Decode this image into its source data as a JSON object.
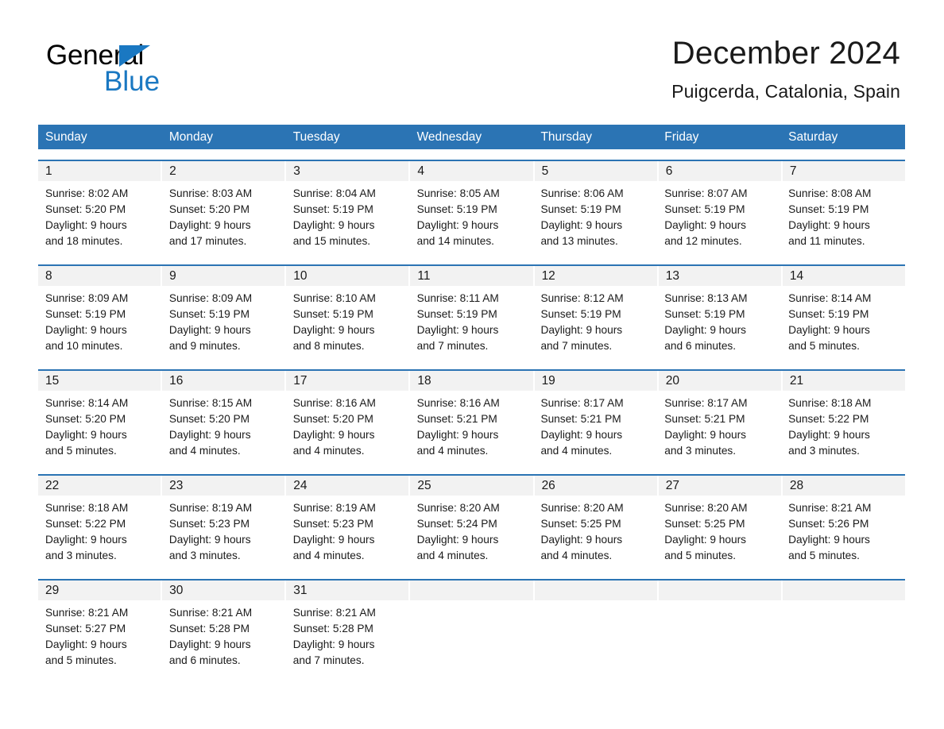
{
  "brand": {
    "name_part1": "General",
    "name_part2": "Blue",
    "triangle_color": "#1a78c2",
    "text_color": "#000000"
  },
  "header": {
    "month_title": "December 2024",
    "location": "Puigcerda, Catalonia, Spain",
    "accent_color": "#2b74b4",
    "band_color": "#f2f2f2"
  },
  "calendar": {
    "weekdays": [
      "Sunday",
      "Monday",
      "Tuesday",
      "Wednesday",
      "Thursday",
      "Friday",
      "Saturday"
    ],
    "weeks": [
      {
        "days": [
          {
            "date": "1",
            "info": "Sunrise: 8:02 AM\nSunset: 5:20 PM\nDaylight: 9 hours\nand 18 minutes."
          },
          {
            "date": "2",
            "info": "Sunrise: 8:03 AM\nSunset: 5:20 PM\nDaylight: 9 hours\nand 17 minutes."
          },
          {
            "date": "3",
            "info": "Sunrise: 8:04 AM\nSunset: 5:19 PM\nDaylight: 9 hours\nand 15 minutes."
          },
          {
            "date": "4",
            "info": "Sunrise: 8:05 AM\nSunset: 5:19 PM\nDaylight: 9 hours\nand 14 minutes."
          },
          {
            "date": "5",
            "info": "Sunrise: 8:06 AM\nSunset: 5:19 PM\nDaylight: 9 hours\nand 13 minutes."
          },
          {
            "date": "6",
            "info": "Sunrise: 8:07 AM\nSunset: 5:19 PM\nDaylight: 9 hours\nand 12 minutes."
          },
          {
            "date": "7",
            "info": "Sunrise: 8:08 AM\nSunset: 5:19 PM\nDaylight: 9 hours\nand 11 minutes."
          }
        ]
      },
      {
        "days": [
          {
            "date": "8",
            "info": "Sunrise: 8:09 AM\nSunset: 5:19 PM\nDaylight: 9 hours\nand 10 minutes."
          },
          {
            "date": "9",
            "info": "Sunrise: 8:09 AM\nSunset: 5:19 PM\nDaylight: 9 hours\nand 9 minutes."
          },
          {
            "date": "10",
            "info": "Sunrise: 8:10 AM\nSunset: 5:19 PM\nDaylight: 9 hours\nand 8 minutes."
          },
          {
            "date": "11",
            "info": "Sunrise: 8:11 AM\nSunset: 5:19 PM\nDaylight: 9 hours\nand 7 minutes."
          },
          {
            "date": "12",
            "info": "Sunrise: 8:12 AM\nSunset: 5:19 PM\nDaylight: 9 hours\nand 7 minutes."
          },
          {
            "date": "13",
            "info": "Sunrise: 8:13 AM\nSunset: 5:19 PM\nDaylight: 9 hours\nand 6 minutes."
          },
          {
            "date": "14",
            "info": "Sunrise: 8:14 AM\nSunset: 5:19 PM\nDaylight: 9 hours\nand 5 minutes."
          }
        ]
      },
      {
        "days": [
          {
            "date": "15",
            "info": "Sunrise: 8:14 AM\nSunset: 5:20 PM\nDaylight: 9 hours\nand 5 minutes."
          },
          {
            "date": "16",
            "info": "Sunrise: 8:15 AM\nSunset: 5:20 PM\nDaylight: 9 hours\nand 4 minutes."
          },
          {
            "date": "17",
            "info": "Sunrise: 8:16 AM\nSunset: 5:20 PM\nDaylight: 9 hours\nand 4 minutes."
          },
          {
            "date": "18",
            "info": "Sunrise: 8:16 AM\nSunset: 5:21 PM\nDaylight: 9 hours\nand 4 minutes."
          },
          {
            "date": "19",
            "info": "Sunrise: 8:17 AM\nSunset: 5:21 PM\nDaylight: 9 hours\nand 4 minutes."
          },
          {
            "date": "20",
            "info": "Sunrise: 8:17 AM\nSunset: 5:21 PM\nDaylight: 9 hours\nand 3 minutes."
          },
          {
            "date": "21",
            "info": "Sunrise: 8:18 AM\nSunset: 5:22 PM\nDaylight: 9 hours\nand 3 minutes."
          }
        ]
      },
      {
        "days": [
          {
            "date": "22",
            "info": "Sunrise: 8:18 AM\nSunset: 5:22 PM\nDaylight: 9 hours\nand 3 minutes."
          },
          {
            "date": "23",
            "info": "Sunrise: 8:19 AM\nSunset: 5:23 PM\nDaylight: 9 hours\nand 3 minutes."
          },
          {
            "date": "24",
            "info": "Sunrise: 8:19 AM\nSunset: 5:23 PM\nDaylight: 9 hours\nand 4 minutes."
          },
          {
            "date": "25",
            "info": "Sunrise: 8:20 AM\nSunset: 5:24 PM\nDaylight: 9 hours\nand 4 minutes."
          },
          {
            "date": "26",
            "info": "Sunrise: 8:20 AM\nSunset: 5:25 PM\nDaylight: 9 hours\nand 4 minutes."
          },
          {
            "date": "27",
            "info": "Sunrise: 8:20 AM\nSunset: 5:25 PM\nDaylight: 9 hours\nand 5 minutes."
          },
          {
            "date": "28",
            "info": "Sunrise: 8:21 AM\nSunset: 5:26 PM\nDaylight: 9 hours\nand 5 minutes."
          }
        ]
      },
      {
        "days": [
          {
            "date": "29",
            "info": "Sunrise: 8:21 AM\nSunset: 5:27 PM\nDaylight: 9 hours\nand 5 minutes."
          },
          {
            "date": "30",
            "info": "Sunrise: 8:21 AM\nSunset: 5:28 PM\nDaylight: 9 hours\nand 6 minutes."
          },
          {
            "date": "31",
            "info": "Sunrise: 8:21 AM\nSunset: 5:28 PM\nDaylight: 9 hours\nand 7 minutes."
          },
          {
            "date": "",
            "info": ""
          },
          {
            "date": "",
            "info": ""
          },
          {
            "date": "",
            "info": ""
          },
          {
            "date": "",
            "info": ""
          }
        ]
      }
    ]
  }
}
